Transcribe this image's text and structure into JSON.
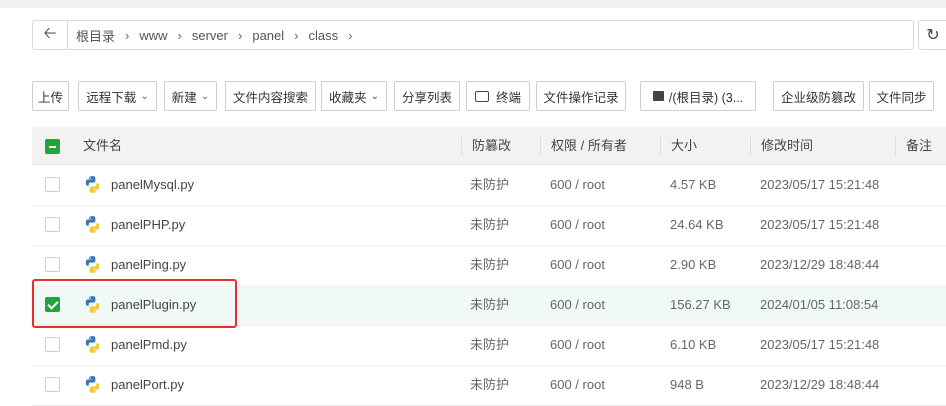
{
  "path": {
    "crumbs": [
      "根目录",
      "www",
      "server",
      "panel",
      "class"
    ],
    "separator": "›"
  },
  "toolbar": {
    "upload": "上传",
    "remote_download": "远程下载",
    "new": "新建",
    "content_search": "文件内容搜索",
    "favorites": "收藏夹",
    "share_list": "分享列表",
    "terminal": "终端",
    "file_log": "文件操作记录",
    "disk": "/(根目录) (3...",
    "tamper_protect": "企业级防篡改",
    "file_sync": "文件同步"
  },
  "table": {
    "headers": {
      "name": "文件名",
      "tamper": "防篡改",
      "perm": "权限 / 所有者",
      "size": "大小",
      "mtime": "修改时间",
      "remark": "备注"
    },
    "rows": [
      {
        "name": "panelMysql.py",
        "tamper": "未防护",
        "perm": "600 / root",
        "size": "4.57 KB",
        "mtime": "2023/05/17 15:21:48",
        "checked": false
      },
      {
        "name": "panelPHP.py",
        "tamper": "未防护",
        "perm": "600 / root",
        "size": "24.64 KB",
        "mtime": "2023/05/17 15:21:48",
        "checked": false
      },
      {
        "name": "panelPing.py",
        "tamper": "未防护",
        "perm": "600 / root",
        "size": "2.90 KB",
        "mtime": "2023/12/29 18:48:44",
        "checked": false
      },
      {
        "name": "panelPlugin.py",
        "tamper": "未防护",
        "perm": "600 / root",
        "size": "156.27 KB",
        "mtime": "2024/01/05 11:08:54",
        "checked": true
      },
      {
        "name": "panelPmd.py",
        "tamper": "未防护",
        "perm": "600 / root",
        "size": "6.10 KB",
        "mtime": "2023/05/17 15:21:48",
        "checked": false
      },
      {
        "name": "panelPort.py",
        "tamper": "未防护",
        "perm": "600 / root",
        "size": "948 B",
        "mtime": "2023/12/29 18:48:44",
        "checked": false
      }
    ]
  },
  "colors": {
    "accent": "#20a53a",
    "highlight_border": "#e5302b",
    "selected_row": "#f0f9f5"
  },
  "icons": [
    "back-arrow-icon",
    "refresh-icon",
    "terminal-icon",
    "disk-icon",
    "python-file-icon"
  ]
}
